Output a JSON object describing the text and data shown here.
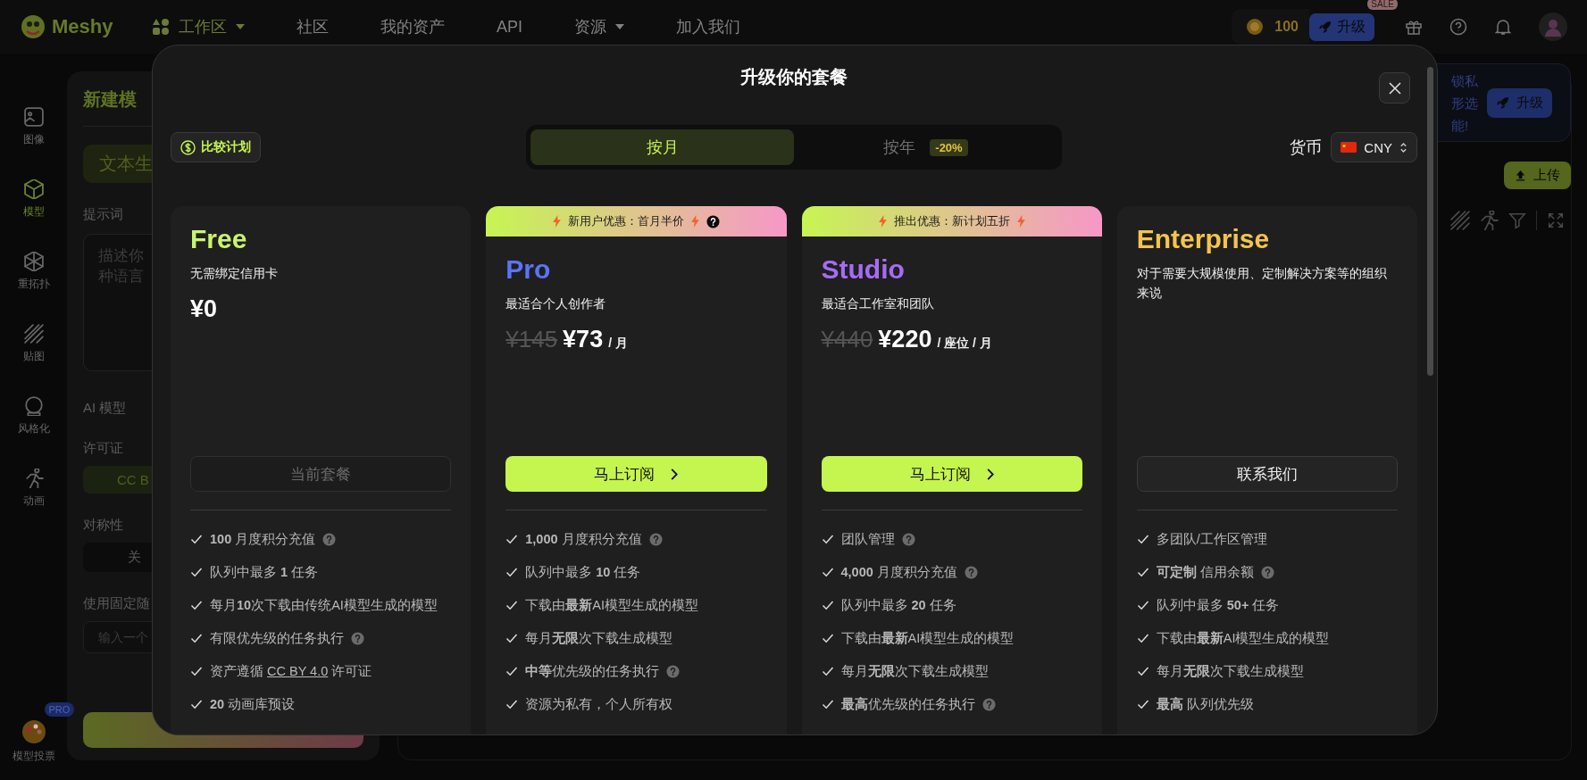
{
  "topbar": {
    "logo": "Meshy",
    "nav": [
      {
        "label": "工作区",
        "kind": "workspace",
        "selected": true
      },
      {
        "label": "社区",
        "kind": "link",
        "selected": false
      },
      {
        "label": "我的资产",
        "kind": "link",
        "selected": false
      },
      {
        "label": "API",
        "kind": "link",
        "selected": false
      },
      {
        "label": "资源",
        "kind": "dropdown",
        "selected": false
      },
      {
        "label": "加入我们",
        "kind": "link",
        "selected": false
      }
    ],
    "credits": "100",
    "upgrade": "升级",
    "sale_badge": "SALE"
  },
  "rail": {
    "items": [
      {
        "label": "图像",
        "kind": "image",
        "selected": false
      },
      {
        "label": "模型",
        "kind": "cube",
        "selected": true
      },
      {
        "label": "重拓扑",
        "kind": "retopo",
        "selected": false
      },
      {
        "label": "贴图",
        "kind": "texture",
        "selected": false
      },
      {
        "label": "风格化",
        "kind": "style",
        "selected": false
      },
      {
        "label": "动画",
        "kind": "animation",
        "selected": false
      }
    ],
    "vote": {
      "label": "模型投票",
      "badge": "PRO"
    }
  },
  "panel": {
    "title": "新建模",
    "tab": "文本生",
    "prompt_label": "提示词",
    "prompt_placeholder": "描述你种语言",
    "model_label": "AI 模型",
    "license_label": "许可证",
    "license_value": "CC B",
    "symmetry_label": "对称性",
    "symmetry_value": "关",
    "seed_label": "使用固定随",
    "seed_placeholder": "输入一个"
  },
  "workspace": {
    "promo_lines": [
      "锁私",
      "形选",
      "能!"
    ],
    "promo_button": "升级",
    "upload": "上传"
  },
  "modal": {
    "title": "升级你的套餐",
    "compare": "比较计划",
    "billing": [
      {
        "label": "按月",
        "selected": true
      },
      {
        "label": "按年",
        "selected": false,
        "badge": "-20%"
      }
    ],
    "currency_label": "货币",
    "currency": "CNY",
    "plans": [
      {
        "name": "Free",
        "color": "#c9f56a",
        "subtitle": "无需绑定信用卡",
        "price": "¥0",
        "button": {
          "label": "当前套餐",
          "kind": "current"
        },
        "features": [
          {
            "text": "**100** 月度积分充值",
            "help": true
          },
          {
            "text": "队列中最多 **1** 任务",
            "help": false
          },
          {
            "text": "每月**10**次下载由传统AI模型生成的模型",
            "help": false
          },
          {
            "text": "有限优先级的任务执行",
            "help": true
          },
          {
            "text": "资产遵循",
            "link": "CC BY 4.0",
            "after": "许可证",
            "help": false
          },
          {
            "text": "**20** 动画库预设",
            "help": false
          }
        ]
      },
      {
        "name": "Pro",
        "color": "#5b74f6",
        "banner": "新用户优惠：首月半价",
        "banner_help": true,
        "subtitle": "最适合个人创作者",
        "old_price": "¥145",
        "price": "¥73",
        "unit": "/ 月",
        "button": {
          "label": "马上订阅",
          "kind": "subscribe"
        },
        "features": [
          {
            "text": "**1,000** 月度积分充值",
            "help": true
          },
          {
            "text": "队列中最多 **10** 任务",
            "help": false
          },
          {
            "text": "下载由**最新**AI模型生成的模型",
            "help": false
          },
          {
            "text": "每月**无限**次下载生成模型",
            "help": false
          },
          {
            "text": "**中等**优先级的任务执行",
            "help": true
          },
          {
            "text": "资源为私有，个人所有权",
            "help": false
          }
        ]
      },
      {
        "name": "Studio",
        "color": "#a66cf5",
        "banner": "推出优惠：新计划五折",
        "banner_help": false,
        "subtitle": "最适合工作室和团队",
        "old_price": "¥440",
        "price": "¥220",
        "unit": "/ 座位 / 月",
        "button": {
          "label": "马上订阅",
          "kind": "subscribe"
        },
        "features": [
          {
            "text": "团队管理",
            "help": true
          },
          {
            "text": "**4,000** 月度积分充值",
            "help": true
          },
          {
            "text": "队列中最多 **20** 任务",
            "help": false
          },
          {
            "text": "下载由**最新**AI模型生成的模型",
            "help": false
          },
          {
            "text": "每月**无限**次下载生成模型",
            "help": false
          },
          {
            "text": "**最高**优先级的任务执行",
            "help": true
          }
        ]
      },
      {
        "name": "Enterprise",
        "color": "#f4c44c",
        "subtitle": "对于需要大规模使用、定制解决方案等的组织来说",
        "button": {
          "label": "联系我们",
          "kind": "contact"
        },
        "features": [
          {
            "text": "多团队/工作区管理",
            "help": false
          },
          {
            "text": "**可定制** 信用余额",
            "help": true
          },
          {
            "text": "队列中最多 **50+** 任务",
            "help": false
          },
          {
            "text": "下载由**最新**AI模型生成的模型",
            "help": false
          },
          {
            "text": "每月**无限**次下载生成模型",
            "help": false
          },
          {
            "text": "**最高** 队列优先级",
            "help": false
          }
        ]
      }
    ]
  }
}
